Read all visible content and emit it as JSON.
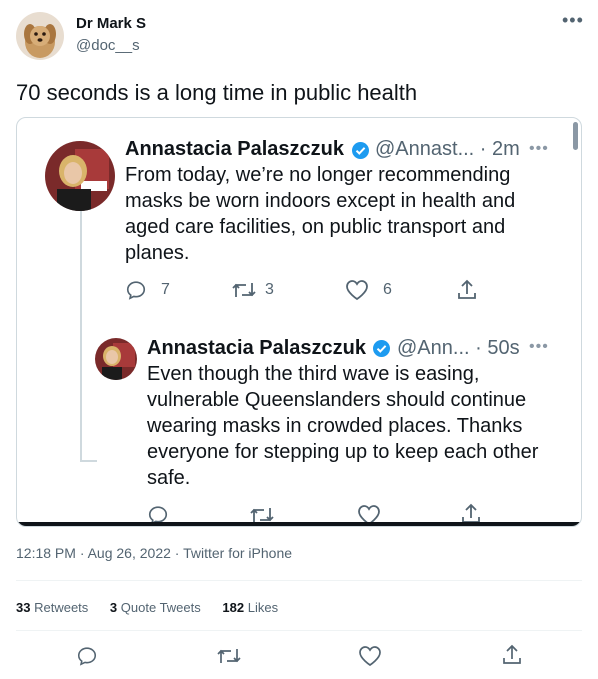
{
  "author": {
    "name": "Dr Mark S",
    "handle": "@doc__s"
  },
  "tweet_text": "70 seconds is a long time in public health",
  "embedded": {
    "tweet1": {
      "name": "Annastacia Palaszczuk",
      "handle_time": "@Annast... · 2m",
      "lines": [
        "From today, we’re no longer recommending",
        "masks be worn indoors except in health and",
        "aged care facilities, on public transport and",
        "planes."
      ],
      "replies": "7",
      "retweets": "3",
      "likes": "6"
    },
    "tweet2": {
      "name": "Annastacia Palaszczuk",
      "handle_time": "@Ann... · 50s",
      "lines": [
        "Even though the third wave is easing,",
        "vulnerable Queenslanders should continue",
        "wearing masks in crowded places. Thanks",
        "everyone for stepping up to keep each other",
        "safe."
      ]
    }
  },
  "meta": "12:18 PM · Aug 26, 2022 · Twitter for iPhone",
  "stats": {
    "retweets_count": "33",
    "retweets_label": "Retweets",
    "quotes_count": "3",
    "quotes_label": "Quote Tweets",
    "likes_count": "182",
    "likes_label": "Likes"
  },
  "icons": {
    "reply": "reply-icon",
    "retweet": "retweet-icon",
    "like": "heart-icon",
    "share": "share-icon"
  }
}
